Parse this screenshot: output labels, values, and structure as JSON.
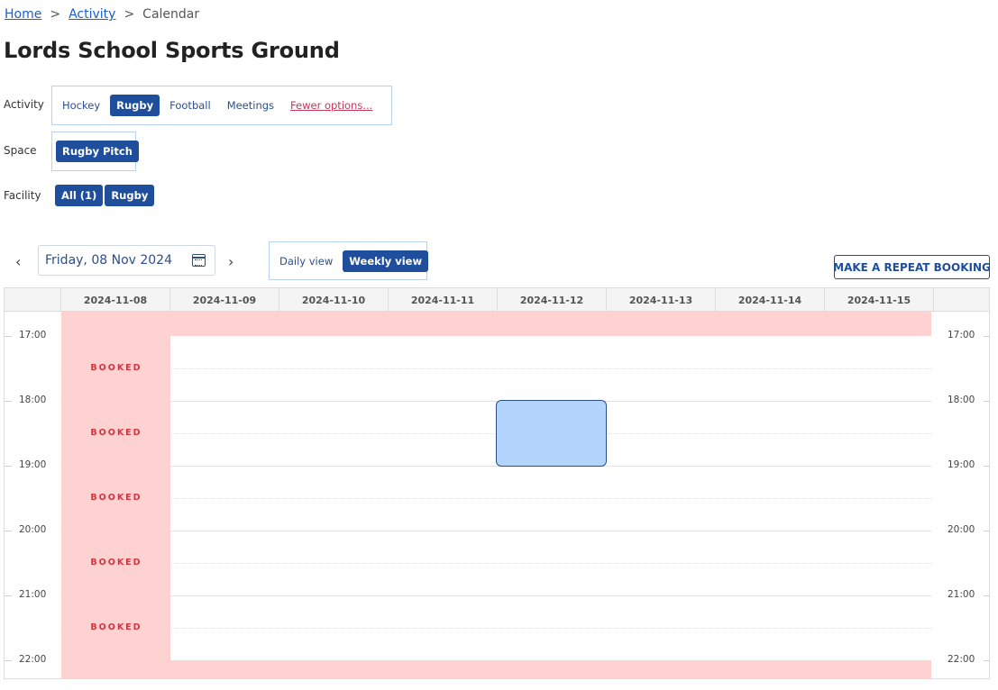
{
  "breadcrumb": {
    "home": "Home",
    "activity": "Activity",
    "current": "Calendar",
    "separator": ">"
  },
  "page": {
    "title": "Lords School Sports Ground"
  },
  "filters": {
    "activity": {
      "label": "Activity",
      "options": [
        "Hockey",
        "Rugby",
        "Football",
        "Meetings"
      ],
      "selected": "Rugby",
      "fewer_link": "Fewer options..."
    },
    "space": {
      "label": "Space",
      "options": [
        "Rugby Pitch"
      ],
      "selected": "Rugby Pitch"
    },
    "facility": {
      "label": "Facility",
      "options": [
        "All (1)",
        "Rugby"
      ]
    }
  },
  "toolbar": {
    "date_value": "Friday, 08 Nov 2024",
    "prev_icon": "chevron-left-icon",
    "next_icon": "chevron-right-icon",
    "calendar_icon": "calendar-icon",
    "views": [
      "Daily view",
      "Weekly view"
    ],
    "selected_view": "Weekly view",
    "repeat_booking": "MAKE A REPEAT BOOKING"
  },
  "calendar": {
    "days": [
      "2024-11-08",
      "2024-11-09",
      "2024-11-10",
      "2024-11-11",
      "2024-11-12",
      "2024-11-13",
      "2024-11-14",
      "2024-11-15"
    ],
    "hours": [
      "17:00",
      "18:00",
      "19:00",
      "20:00",
      "21:00",
      "22:00"
    ],
    "booked_label": "BOOKED",
    "booked_slots": [
      "17:30",
      "18:30",
      "19:30",
      "20:30",
      "21:30"
    ],
    "selected_slot": {
      "day": "2024-11-12",
      "start": "18:00",
      "end": "19:00"
    },
    "colors": {
      "booked_bg": "#ffd2d2",
      "booked_text": "#d6323f",
      "selection_bg": "#b3d4fb",
      "accent": "#1f4e9c"
    }
  }
}
